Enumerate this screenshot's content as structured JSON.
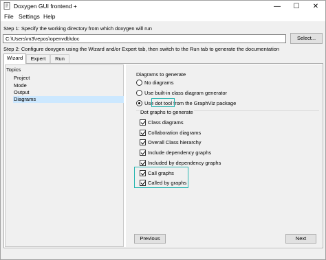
{
  "window": {
    "title": "Doxygen GUI frontend +",
    "controls": {
      "minimize": "—",
      "maximize": "☐",
      "close": "✕"
    }
  },
  "menu": {
    "file": "File",
    "settings": "Settings",
    "help": "Help"
  },
  "step1": {
    "label": "Step 1: Specify the working directory from which doxygen will run",
    "directory_value": "C:\\Users\\m3\\repos\\openvdb\\doc",
    "select_button": "Select..."
  },
  "step2": {
    "label": "Step 2: Configure doxygen using the Wizard and/or Expert tab, then switch to the Run tab to generate the documentation"
  },
  "tabs": {
    "wizard": "Wizard",
    "expert": "Expert",
    "run": "Run",
    "active": "Wizard"
  },
  "topics": {
    "heading": "Topics",
    "items": [
      "Project",
      "Mode",
      "Output",
      "Diagrams"
    ],
    "selected": "Diagrams"
  },
  "diagrams": {
    "heading": "Diagrams to generate",
    "options": {
      "none": "No diagrams",
      "builtin": "Use built-in class diagram generator",
      "dot_prefix": "Use ",
      "dot_highlight": "dot tool",
      "dot_suffix": " from the GraphViz package"
    },
    "selected_option": "dot",
    "dot_graphs": {
      "heading": "Dot graphs to generate",
      "items": [
        {
          "label": "Class diagrams",
          "checked": true
        },
        {
          "label": "Collaboration diagrams",
          "checked": true
        },
        {
          "label": "Overall Class hierarchy",
          "checked": true
        },
        {
          "label": "Include dependency graphs",
          "checked": true
        },
        {
          "label": "Included by dependency graphs",
          "checked": true
        },
        {
          "label": "Call graphs",
          "checked": true
        },
        {
          "label": "Called by graphs",
          "checked": true
        }
      ]
    }
  },
  "buttons": {
    "previous": "Previous",
    "next": "Next"
  },
  "colors": {
    "highlight_box": "#26b5b0",
    "selection": "#cce8ff"
  }
}
